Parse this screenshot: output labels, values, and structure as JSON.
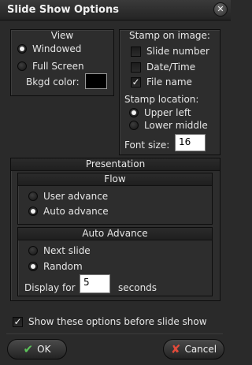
{
  "window": {
    "title": "Slide Show Options",
    "close_glyph": "✕"
  },
  "view": {
    "heading": "View",
    "options": [
      {
        "label": "Windowed",
        "selected": true
      },
      {
        "label": "Full Screen",
        "selected": false
      }
    ],
    "bkgd_label": "Bkgd color:",
    "bkgd_color": "#000000"
  },
  "stamp": {
    "heading": "Stamp on image:",
    "checks": [
      {
        "label": "Slide number",
        "checked": false
      },
      {
        "label": "Date/Time",
        "checked": false
      },
      {
        "label": "File name",
        "checked": true
      }
    ],
    "location_label": "Stamp location:",
    "locations": [
      {
        "label": "Upper left",
        "selected": true
      },
      {
        "label": "Lower middle",
        "selected": false
      }
    ],
    "font_size_label": "Font size:",
    "font_size": "16"
  },
  "presentation": {
    "heading": "Presentation",
    "flow": {
      "heading": "Flow",
      "options": [
        {
          "label": "User advance",
          "selected": false
        },
        {
          "label": "Auto advance",
          "selected": true
        }
      ]
    },
    "auto": {
      "heading": "Auto Advance",
      "options": [
        {
          "label": "Next slide",
          "selected": false
        },
        {
          "label": "Random",
          "selected": true
        }
      ],
      "display_for_label": "Display for",
      "display_for_value": "5",
      "seconds_label": "seconds"
    }
  },
  "show_options": {
    "label": "Show these options before slide show",
    "checked": true
  },
  "buttons": {
    "ok": "OK",
    "cancel": "Cancel"
  },
  "icons": {
    "ok": "check-icon",
    "cancel": "cross-icon"
  },
  "colors": {
    "ok_icon": "#5cc35a",
    "cancel_icon": "#e24a3a"
  }
}
